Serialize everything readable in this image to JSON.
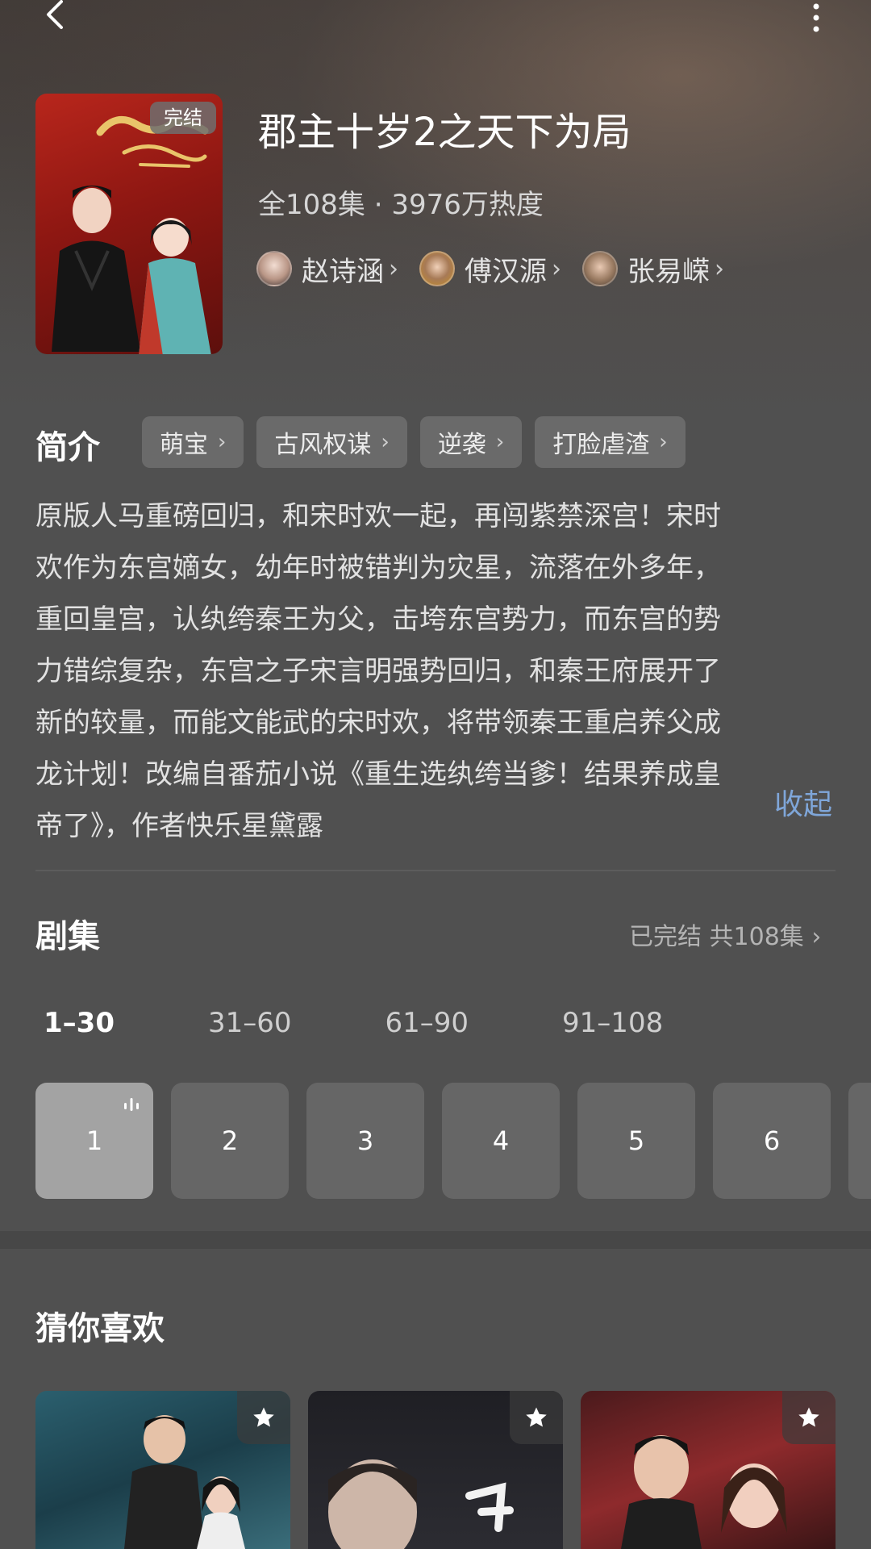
{
  "show": {
    "title": "郡主十岁2之天下为局",
    "badge": "完结",
    "meta": "全108集 · 3976万热度",
    "cast": [
      {
        "name": "赵诗涵",
        "chevron": "›"
      },
      {
        "name": "傅汉源",
        "chevron": "›"
      },
      {
        "name": "张易嵘",
        "chevron": "›"
      }
    ]
  },
  "intro": {
    "label": "简介",
    "tags": [
      {
        "label": "萌宝",
        "chevron": "›"
      },
      {
        "label": "古风权谋",
        "chevron": "›"
      },
      {
        "label": "逆袭",
        "chevron": "›"
      },
      {
        "label": "打脸虐渣",
        "chevron": "›"
      }
    ],
    "description_lines": [
      "原版人马重磅回归，和宋时欢一起，再闯紫禁深宫！宋时",
      "欢作为东宫嫡女，幼年时被错判为灾星，流落在外多年，",
      "重回皇宫，认纨绔秦王为父，击垮东宫势力，而东宫的势",
      "力错综复杂，东宫之子宋言明强势回归，和秦王府展开了",
      "新的较量，而能文能武的宋时欢，将带领秦王重启养父成",
      "龙计划！改编自番茄小说《重生选纨绔当爹！结果养成皇",
      "帝了》，作者快乐星黛露"
    ],
    "collapse_label": "收起"
  },
  "episodes": {
    "label": "剧集",
    "status": "已完结 共108集 ›",
    "ranges": [
      "1–30",
      "31–60",
      "61–90",
      "91–108"
    ],
    "active_range": 0,
    "items": [
      "1",
      "2",
      "3",
      "4",
      "5",
      "6"
    ],
    "active_episode": 0
  },
  "recommend": {
    "label": "猜你喜欢"
  },
  "colors": {
    "background": "#505050",
    "accent_link": "#7fa6d9",
    "tile": "#666666",
    "tile_active": "#a3a3a3"
  },
  "icons": {
    "back": "back-arrow-icon",
    "more": "more-vertical-icon",
    "playing": "playing-bars-icon",
    "favorite": "star-icon"
  }
}
